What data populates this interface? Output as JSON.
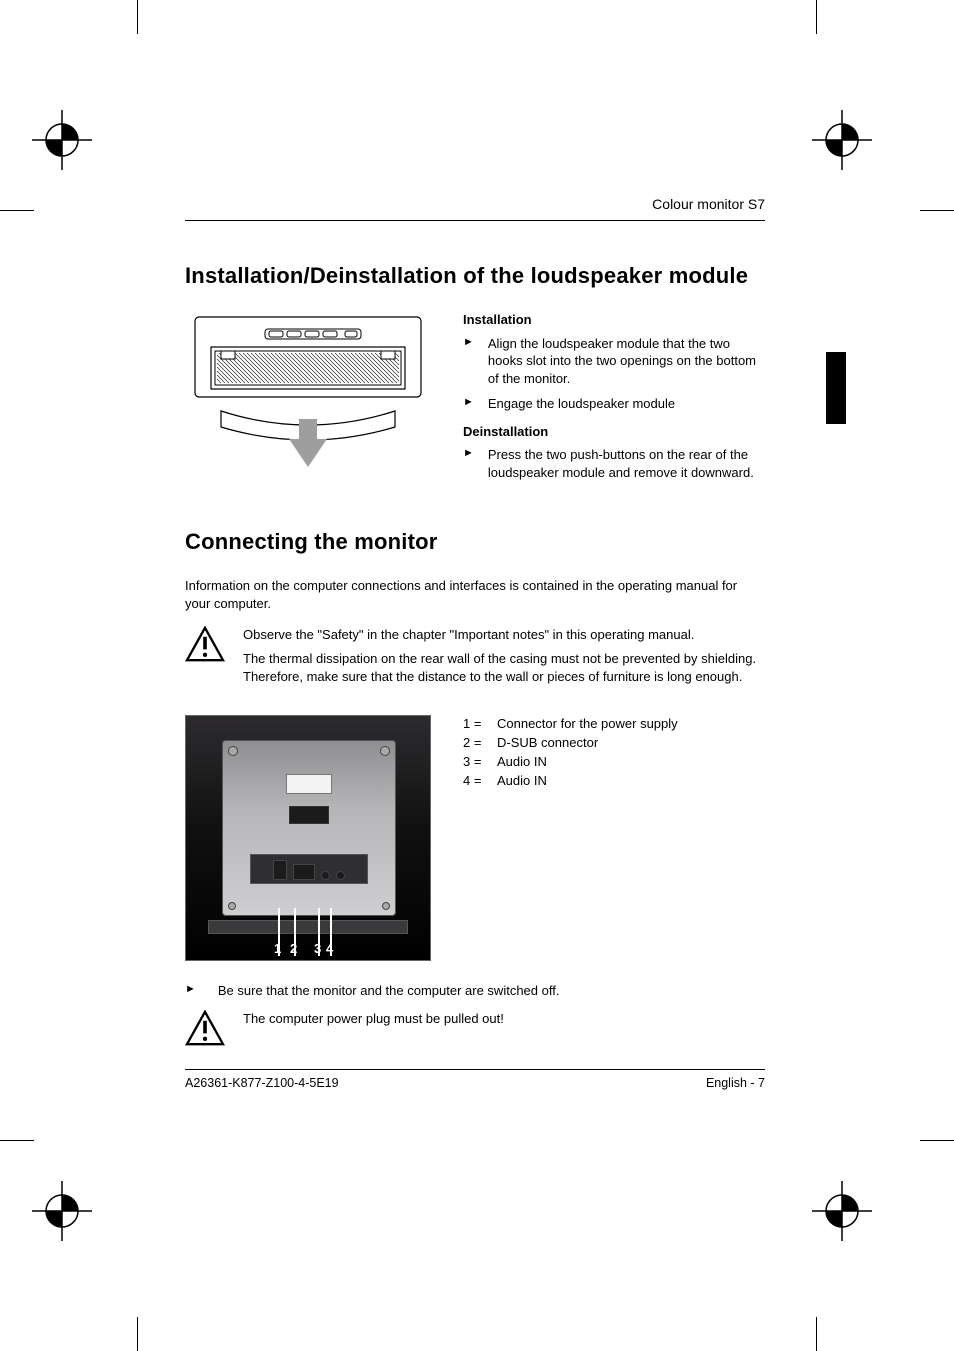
{
  "header": {
    "model": "Colour monitor S7"
  },
  "section1": {
    "title": "Installation/Deinstallation of the loudspeaker module",
    "install_h": "Installation",
    "install_step1": "Align the loudspeaker module that the two hooks slot into the two openings on the bottom of the monitor.",
    "install_step2": "Engage the loudspeaker module",
    "deinstall_h": "Deinstallation",
    "deinstall_step1": "Press the two push-buttons on the rear of the loudspeaker module and remove it downward."
  },
  "section2": {
    "title": "Connecting the monitor",
    "intro": "Information on the computer connections and interfaces is contained in the operating manual for your computer.",
    "warn1_line1": "Observe the \"Safety\" in the chapter \"Important notes\" in this operating manual.",
    "warn1_line2": "The thermal dissipation on the rear wall of the casing must not be prevented by shielding. Therefore, make sure that the distance to the wall or pieces of furniture is long enough.",
    "legend": {
      "1": "Connector for the power supply",
      "2": "D-SUB connector",
      "3": "Audio IN",
      "4": "Audio IN"
    },
    "photo_labels": {
      "n1": "1",
      "n2": "2",
      "n3": "3",
      "n4": "4"
    },
    "step_off": "Be sure that the monitor and the computer are switched off.",
    "warn2": "The computer power plug must be pulled out!"
  },
  "footer": {
    "doc_no": "A26361-K877-Z100-4-5E19",
    "page": "English - 7"
  },
  "glyph": {
    "tri": "►"
  }
}
